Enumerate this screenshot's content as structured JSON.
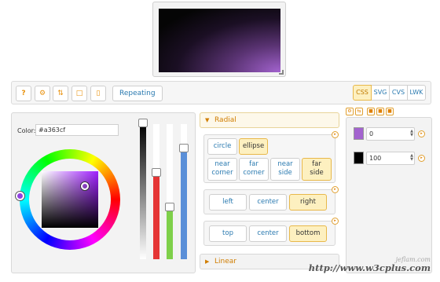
{
  "preview": {
    "gradient_colors": [
      "#a363cf",
      "#000000"
    ]
  },
  "toolbar": {
    "icons": [
      "help-icon",
      "gear-icon",
      "arrows-icon",
      "folder-icon",
      "page-icon"
    ],
    "help_label": "?",
    "repeating_label": "Repeating",
    "formats": [
      "CSS",
      "SVG",
      "CVS",
      "LWK"
    ],
    "active_format": "CSS"
  },
  "color_picker": {
    "label": "Color:",
    "value": "#a363cf"
  },
  "radial": {
    "header": "Radial",
    "shape": {
      "circle": "circle",
      "ellipse": "ellipse",
      "near_corner_1": "near",
      "near_corner_2": "corner",
      "far_corner_1": "far",
      "far_corner_2": "corner",
      "near_side_1": "near",
      "near_side_2": "side",
      "far_side_1": "far",
      "far_side_2": "side"
    },
    "horizontal": [
      "left",
      "center",
      "right"
    ],
    "vertical": [
      "top",
      "center",
      "bottom"
    ]
  },
  "linear": {
    "header": "Linear"
  },
  "stops": [
    {
      "color": "#a363cf",
      "position": "0"
    },
    {
      "color": "#000000",
      "position": "100"
    }
  ],
  "watermark": {
    "small": "jeflam.com",
    "big": "http://www.w3cplus.com"
  }
}
